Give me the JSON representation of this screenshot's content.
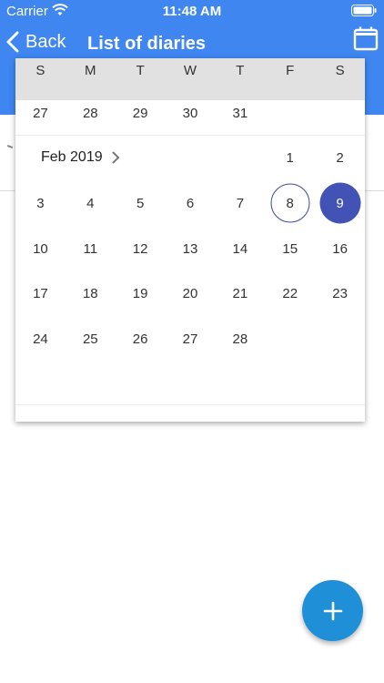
{
  "status_bar": {
    "carrier": "Carrier",
    "time": "11:48 AM"
  },
  "nav": {
    "back_label": "Back",
    "title": "List of diaries"
  },
  "calendar": {
    "weekdays": [
      "S",
      "M",
      "T",
      "W",
      "T",
      "F",
      "S"
    ],
    "prev_tail": [
      "27",
      "28",
      "29",
      "30",
      "31"
    ],
    "month_label": "Feb 2019",
    "first_week": [
      "1",
      "2"
    ],
    "weeks": [
      [
        "3",
        "4",
        "5",
        "6",
        "7",
        "8",
        "9"
      ],
      [
        "10",
        "11",
        "12",
        "13",
        "14",
        "15",
        "16"
      ],
      [
        "17",
        "18",
        "19",
        "20",
        "21",
        "22",
        "23"
      ],
      [
        "24",
        "25",
        "26",
        "27",
        "28"
      ]
    ],
    "today": "8",
    "selected": "9"
  },
  "fab": {
    "icon": "plus-icon"
  },
  "colors": {
    "primary": "#3f86f1",
    "selected": "#4253b5",
    "fab": "#1f8fd8",
    "header_bg": "#e1e1e1"
  }
}
